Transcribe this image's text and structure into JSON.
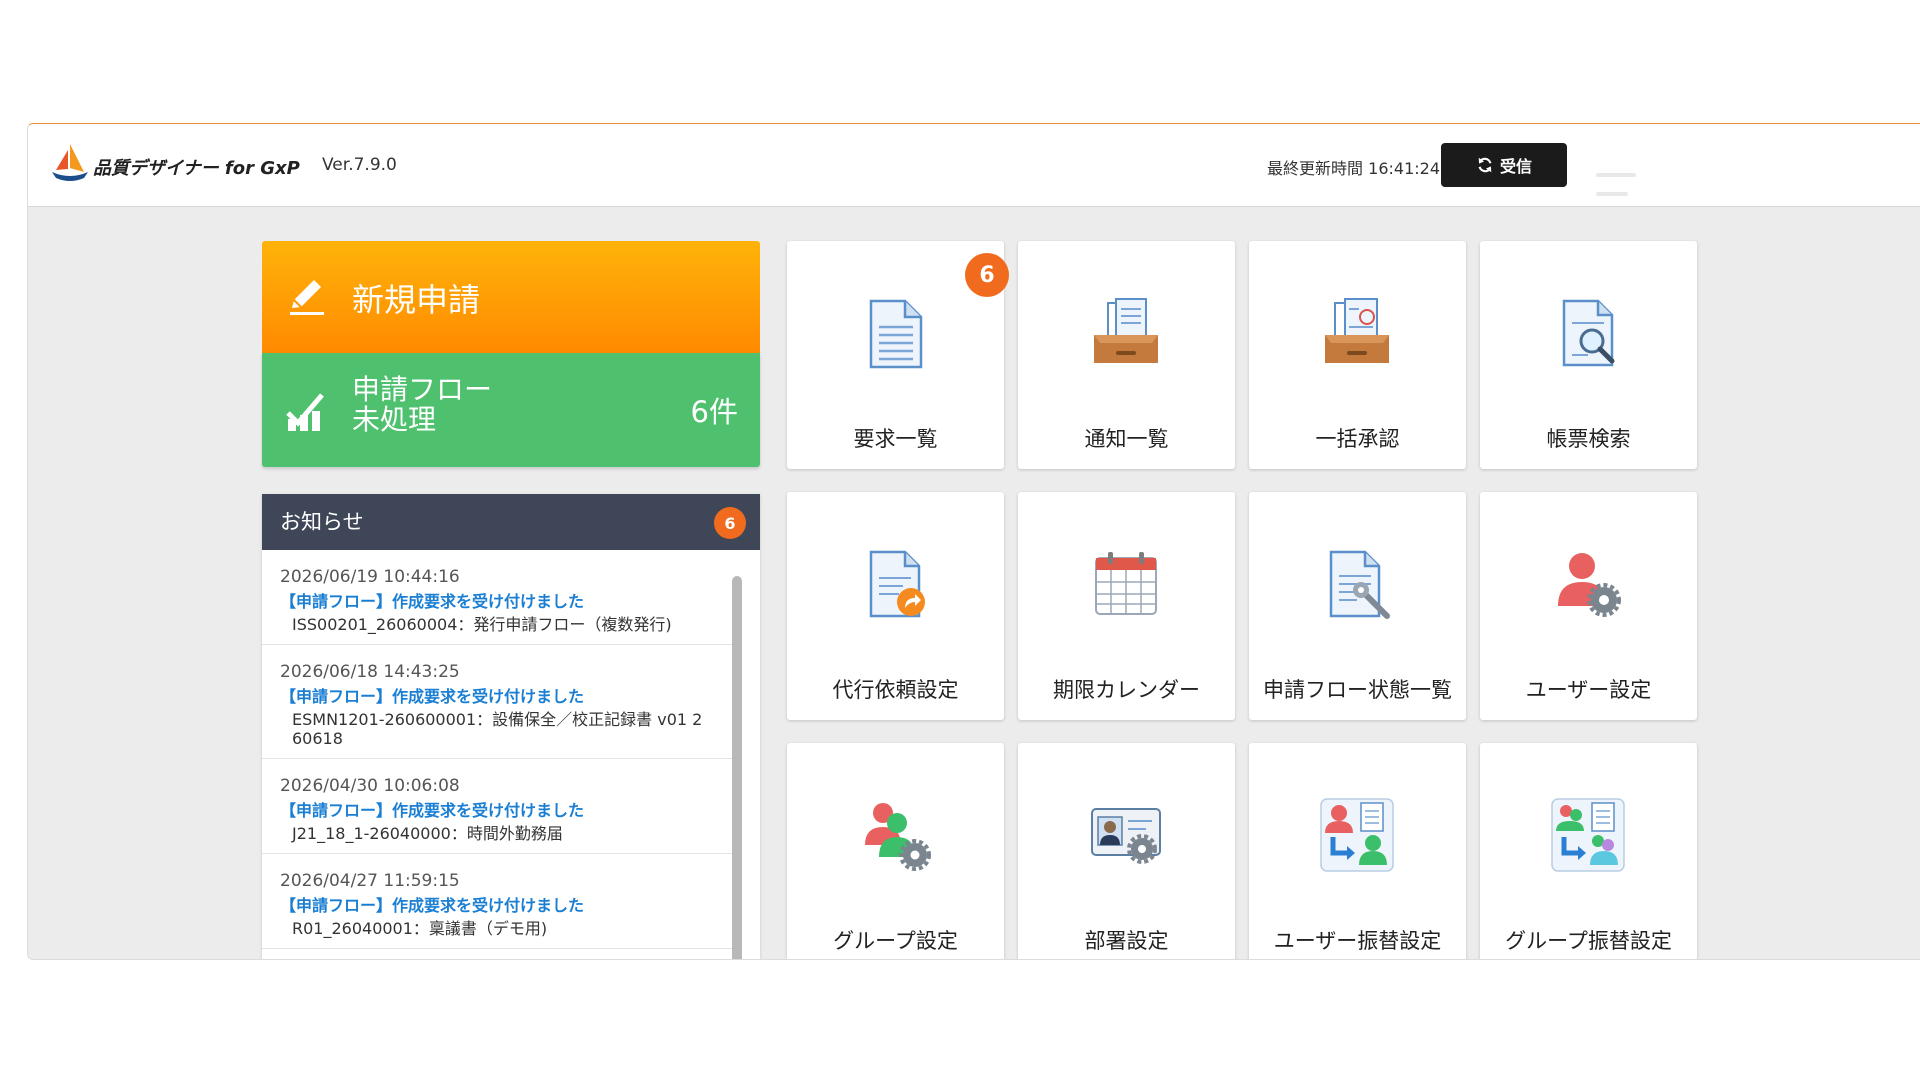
{
  "header": {
    "app_name": "品質デザイナー for GxP",
    "version": "Ver.7.9.0",
    "last_updated": "最終更新時間 16:41:24",
    "receive_label": "受信"
  },
  "colors": {
    "accent_orange": "#ff9800",
    "flow_green": "#4fc16e",
    "notice_header": "#3f4658",
    "badge": "#f06b1d",
    "link_blue": "#1a7fd4"
  },
  "new_application": {
    "label": "新規申請"
  },
  "flow_pending": {
    "line1": "申請フロー",
    "line2": "未処理",
    "count": "6件"
  },
  "notice": {
    "title": "お知らせ",
    "badge": "6",
    "items": [
      {
        "date": "2026/06/19 10:44:16",
        "title": "【申請フロー】作成要求を受け付けました",
        "desc": "ISS00201_26060004：発行申請フロー（複数発行)"
      },
      {
        "date": "2026/06/18 14:43:25",
        "title": "【申請フロー】作成要求を受け付けました",
        "desc": "ESMN1201-260600001：設備保全／校正記録書 v01 2",
        "desc2": "60618"
      },
      {
        "date": "2026/04/30 10:06:08",
        "title": "【申請フロー】作成要求を受け付けました",
        "desc": "J21_18_1-26040000：時間外勤務届"
      },
      {
        "date": "2026/04/27 11:59:15",
        "title": "【申請フロー】作成要求を受け付けました",
        "desc": "R01_26040001：稟議書（デモ用)"
      }
    ]
  },
  "tiles": [
    {
      "label": "要求一覧",
      "badge": "6",
      "icon": "document-icon"
    },
    {
      "label": "通知一覧",
      "icon": "inbox-tray-icon"
    },
    {
      "label": "一括承認",
      "icon": "approval-tray-icon"
    },
    {
      "label": "帳票検索",
      "icon": "document-search-icon"
    },
    {
      "label": "代行依頼設定",
      "icon": "document-forward-icon"
    },
    {
      "label": "期限カレンダー",
      "icon": "calendar-icon"
    },
    {
      "label": "申請フロー状態一覧",
      "icon": "document-wrench-icon"
    },
    {
      "label": "ユーザー設定",
      "icon": "user-gear-icon"
    },
    {
      "label": "グループ設定",
      "icon": "group-gear-icon"
    },
    {
      "label": "部署設定",
      "icon": "id-card-gear-icon"
    },
    {
      "label": "ユーザー振替設定",
      "icon": "user-transfer-icon"
    },
    {
      "label": "グループ振替設定",
      "icon": "group-transfer-icon"
    }
  ]
}
